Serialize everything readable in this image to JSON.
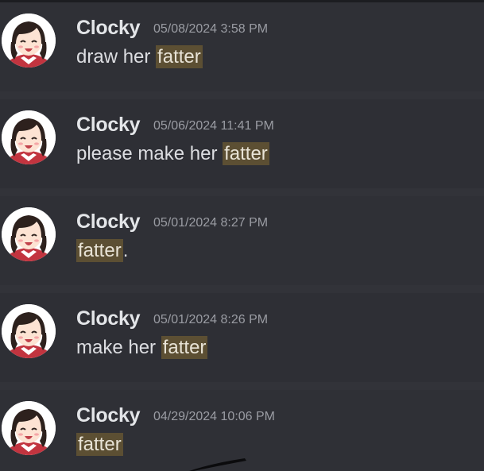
{
  "messages": [
    {
      "username": "Clocky",
      "timestamp": "05/08/2024 3:58 PM",
      "text_before": "draw her ",
      "highlight": "fatter",
      "text_after": ""
    },
    {
      "username": "Clocky",
      "timestamp": "05/06/2024 11:41 PM",
      "text_before": "please make her ",
      "highlight": "fatter",
      "text_after": ""
    },
    {
      "username": "Clocky",
      "timestamp": "05/01/2024 8:27 PM",
      "text_before": "",
      "highlight": "fatter",
      "text_after": "."
    },
    {
      "username": "Clocky",
      "timestamp": "05/01/2024 8:26 PM",
      "text_before": "make her ",
      "highlight": "fatter",
      "text_after": ""
    },
    {
      "username": "Clocky",
      "timestamp": "04/29/2024 10:06 PM",
      "text_before": "",
      "highlight": "fatter",
      "text_after": ""
    }
  ],
  "avatar": {
    "icon": "anime-girl-avatar-icon"
  },
  "colors": {
    "background": "#323339",
    "username": "#e3e5e8",
    "timestamp": "#9a9ca3",
    "message_text": "#dcdde1",
    "search_highlight": "#5c4f33"
  }
}
